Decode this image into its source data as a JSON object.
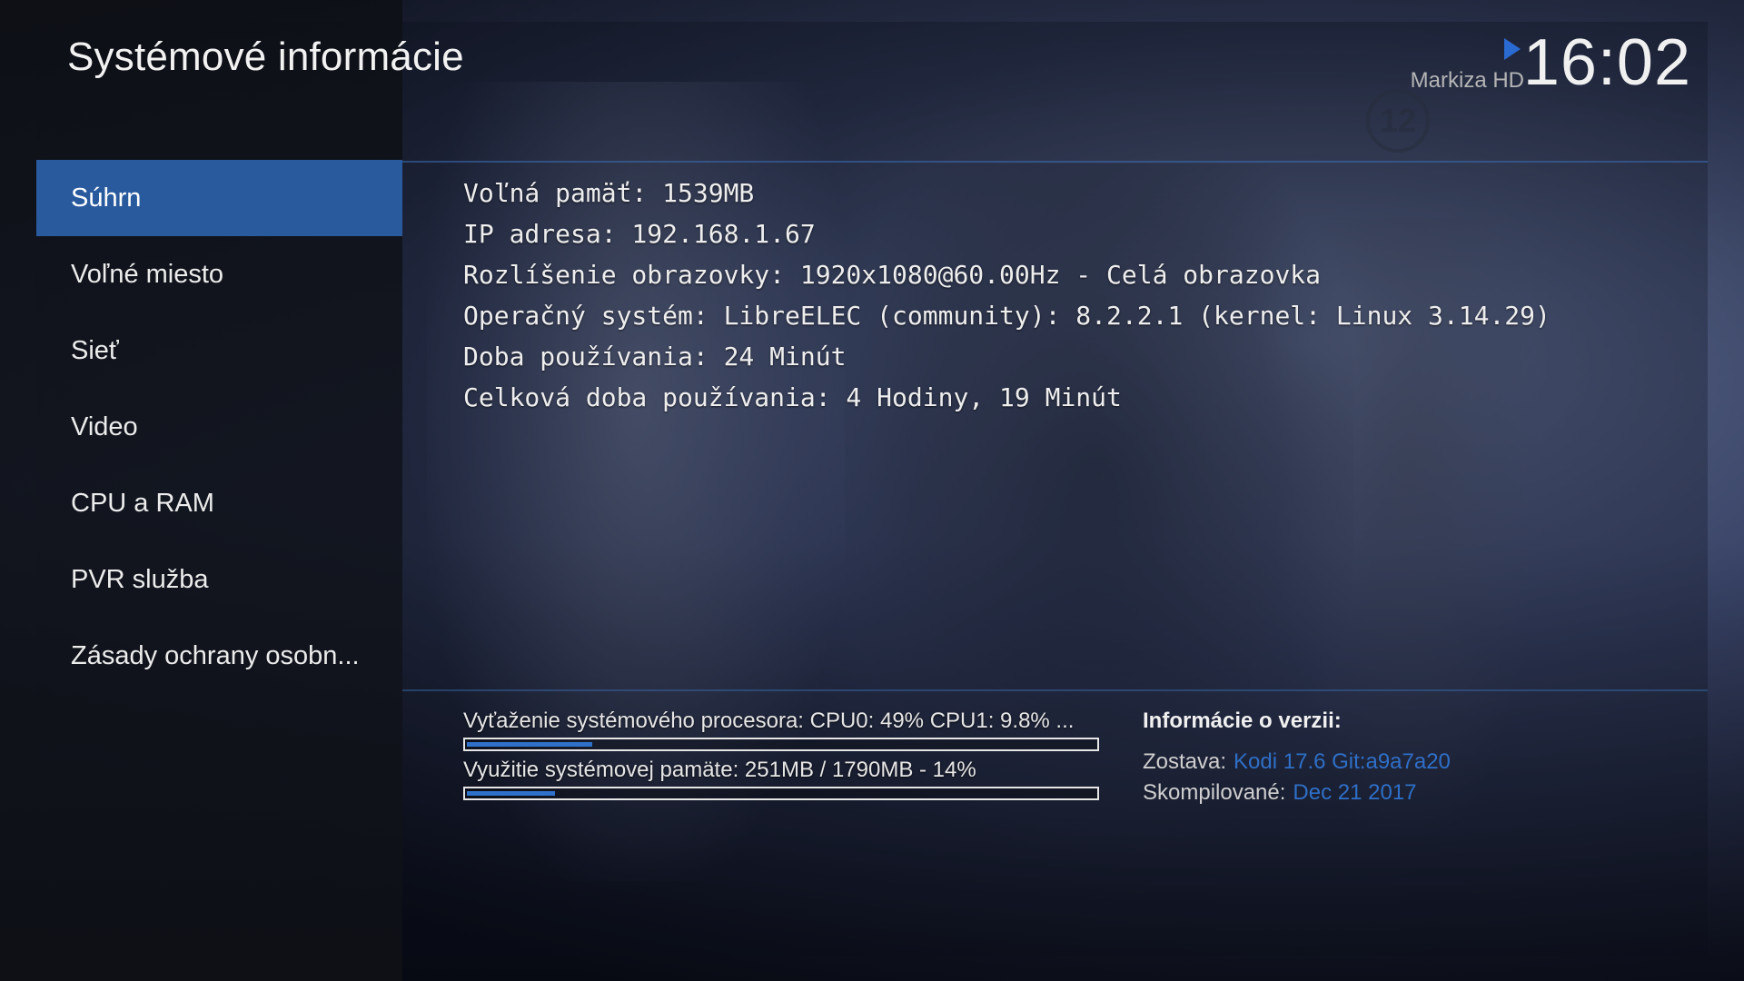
{
  "header": {
    "title": "Systémové informácie",
    "now_playing": {
      "icon": "play-icon",
      "channel": "Markiza HD"
    },
    "clock": "16:02"
  },
  "video_overlay": {
    "rating_badge": "12"
  },
  "sidebar": {
    "items": [
      {
        "label": "Súhrn",
        "selected": true
      },
      {
        "label": "Voľné miesto",
        "selected": false
      },
      {
        "label": "Sieť",
        "selected": false
      },
      {
        "label": "Video",
        "selected": false
      },
      {
        "label": "CPU a RAM",
        "selected": false
      },
      {
        "label": "PVR služba",
        "selected": false
      },
      {
        "label": "Zásady ochrany osobn...",
        "selected": false
      }
    ]
  },
  "summary": {
    "lines": [
      "Voľná pamäť: 1539MB",
      "IP adresa: 192.168.1.67",
      "Rozlíšenie obrazovky: 1920x1080@60.00Hz - Celá obrazovka",
      "Operačný systém: LibreELEC (community): 8.2.2.1 (kernel: Linux 3.14.29)",
      "Doba používania: 24 Minút",
      "Celková doba používania: 4 Hodiny, 19 Minút"
    ]
  },
  "usage": {
    "cpu": {
      "label": "Vyťaženie systémového procesora: CPU0:  49% CPU1: 9.8% ...",
      "fraction": 0.2
    },
    "memory": {
      "label": "Využitie systémovej pamäte: 251MB / 1790MB - 14%",
      "fraction": 0.14
    }
  },
  "version": {
    "title": "Informácie o verzii:",
    "build_key": "Zostava:",
    "build_value": "Kodi 17.6 Git:a9a7a20",
    "compiled_key": "Skompilované:",
    "compiled_value": "Dec 21 2017"
  },
  "colors": {
    "accent": "#2a5a9e",
    "progress": "#2f71c9",
    "link": "#2f6fc7"
  }
}
